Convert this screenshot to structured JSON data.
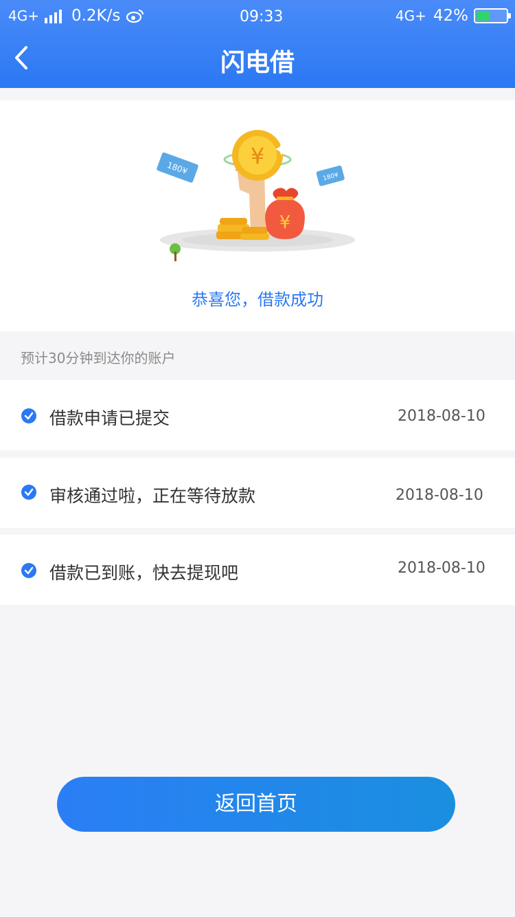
{
  "status_bar": {
    "network_left": "4G+",
    "speed": "0.2K/s",
    "time": "09:33",
    "network_right": "4G+",
    "battery_text": "42%",
    "battery_level": 0.42
  },
  "header": {
    "title": "闪电借",
    "back_icon": "chevron-left-icon"
  },
  "hero": {
    "illustration_texts": [
      "180¥",
      "180¥"
    ],
    "success_text": "恭喜您，借款成功"
  },
  "estimate_text": "预计30分钟到达你的账户",
  "steps": [
    {
      "label": "借款申请已提交",
      "date": "2018-08-10",
      "icon": "check-circle-icon"
    },
    {
      "label": "审核通过啦，正在等待放款",
      "date": "2018-08-10",
      "icon": "check-circle-icon"
    },
    {
      "label": "借款已到账，快去提现吧",
      "date": "2018-08-10",
      "icon": "check-circle-icon"
    }
  ],
  "home_button_label": "返回首页",
  "colors": {
    "accent": "#2b78f3",
    "check": "#2b78f3",
    "coin": "#f5b820",
    "bag": "#e8452f"
  }
}
